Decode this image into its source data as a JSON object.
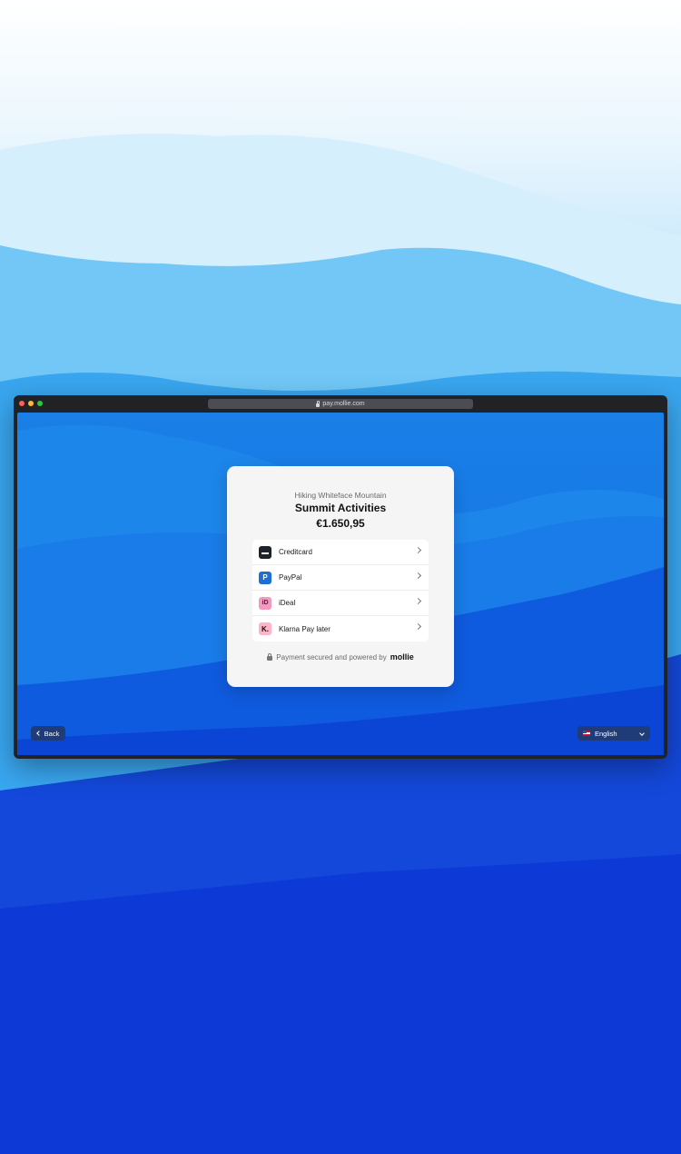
{
  "browser": {
    "url": "pay.mollie.com"
  },
  "checkout": {
    "subtitle": "Hiking Whiteface Mountain",
    "title": "Summit Activities",
    "amount": "€1.650,95",
    "methods": [
      {
        "label": "Creditcard",
        "icon": "credit-card-icon"
      },
      {
        "label": "PayPal",
        "icon": "paypal-icon",
        "glyph": "P"
      },
      {
        "label": "iDeal",
        "icon": "ideal-icon",
        "glyph": "iD"
      },
      {
        "label": "Klarna Pay later",
        "icon": "klarna-icon",
        "glyph": "K."
      }
    ],
    "secure_text": "Payment secured and powered by",
    "brand": "mollie"
  },
  "footer": {
    "back_label": "Back",
    "language_label": "English"
  },
  "colors": {
    "card_bg": "#f5f5f5",
    "button_bg": "#1f3c78",
    "paypal": "#1f6fd1",
    "ideal": "#f29ac0",
    "klarna": "#ffb3c7"
  }
}
